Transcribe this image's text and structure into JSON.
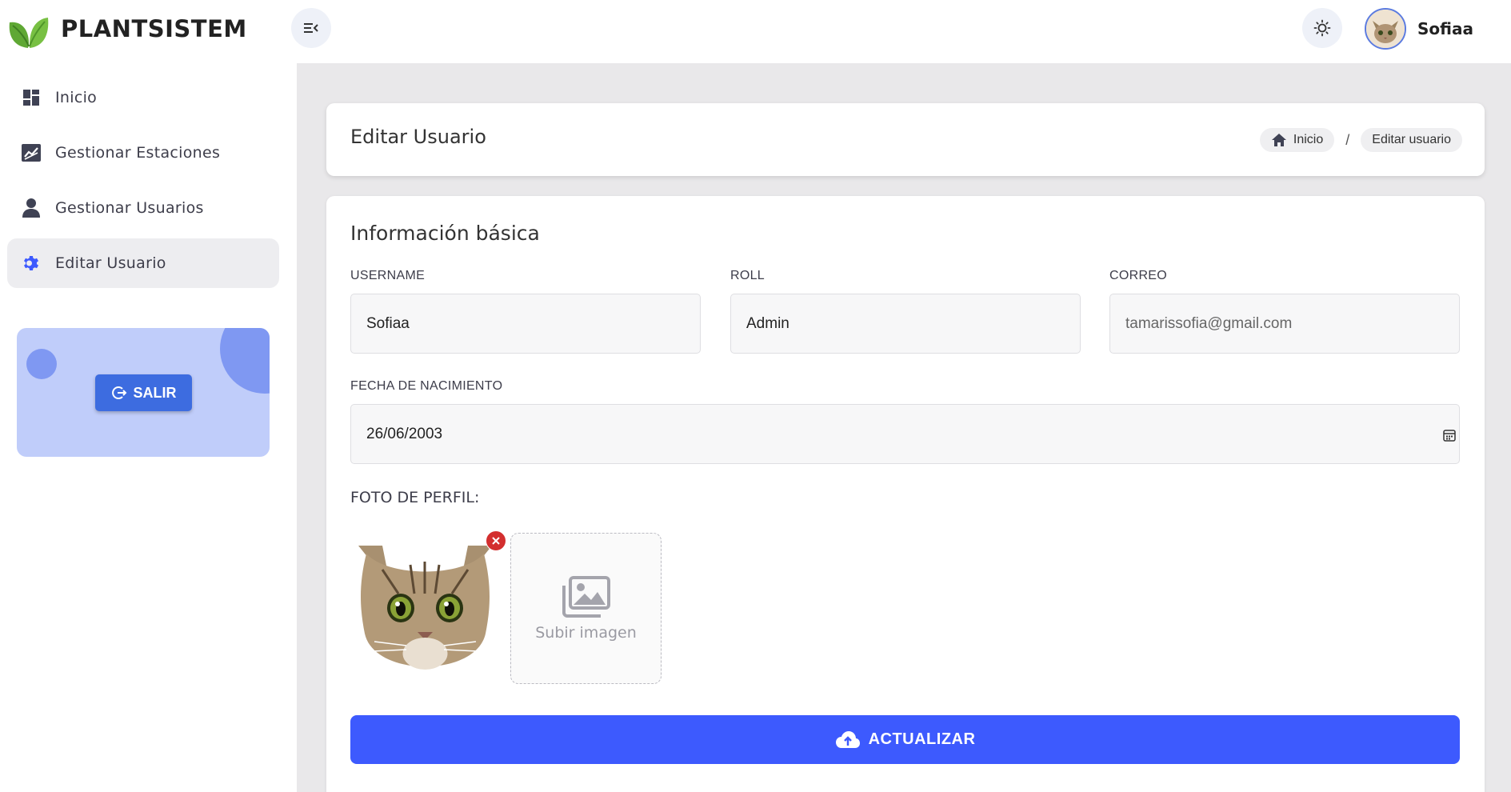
{
  "header": {
    "brand": "PLANTSISTEM",
    "user_name": "Sofiaa",
    "menu_icon": "menu-collapse-icon",
    "theme_icon": "sun-icon"
  },
  "sidebar": {
    "items": [
      {
        "label": "Inicio",
        "icon": "dashboard-icon"
      },
      {
        "label": "Gestionar Estaciones",
        "icon": "chart-icon"
      },
      {
        "label": "Gestionar Usuarios",
        "icon": "user-icon"
      },
      {
        "label": "Editar Usuario",
        "icon": "gear-icon",
        "active": true
      }
    ],
    "logout_label": "SALIR"
  },
  "page": {
    "title": "Editar Usuario",
    "breadcrumb": [
      "Inicio",
      "Editar usuario"
    ],
    "breadcrumb_sep": "/"
  },
  "form": {
    "section_title": "Información básica",
    "username": {
      "label": "USERNAME",
      "value": "Sofiaa"
    },
    "roll": {
      "label": "ROLL",
      "value": "Admin"
    },
    "correo": {
      "label": "CORREO",
      "value": "tamarissofia@gmail.com"
    },
    "fecha": {
      "label": "FECHA DE NACIMIENTO",
      "value": "26/06/2003"
    },
    "photo_label": "FOTO DE PERFIL:",
    "upload_text": "Subir imagen",
    "submit_label": "ACTUALIZAR"
  },
  "colors": {
    "accent": "#3d5afe",
    "logout_button": "#3d6ce0",
    "logout_card": "#c0cdfa",
    "remove": "#d32f2f"
  }
}
